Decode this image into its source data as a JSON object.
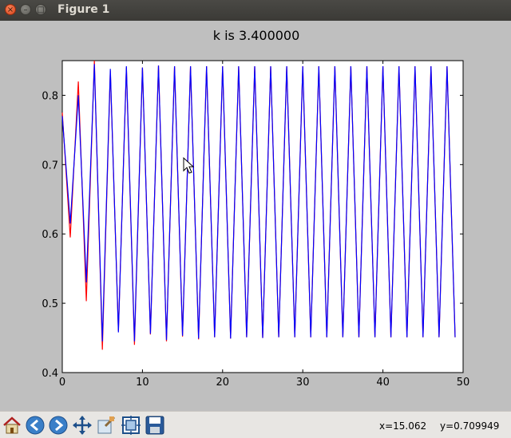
{
  "window": {
    "title": "Figure 1",
    "close_glyph": "×",
    "min_glyph": "–",
    "max_glyph": "□"
  },
  "toolbar": {
    "tools": [
      "home-icon",
      "back-icon",
      "forward-icon",
      "pan-icon",
      "zoom-icon",
      "subplots-icon",
      "save-icon"
    ],
    "x_readout": "x=15.062",
    "y_readout": "y=0.709949"
  },
  "chart_data": {
    "type": "line",
    "title": "k is 3.400000",
    "xlabel": "",
    "ylabel": "",
    "xlim": [
      0,
      50
    ],
    "ylim": [
      0.4,
      0.85
    ],
    "xticks": [
      0,
      10,
      20,
      30,
      40,
      50
    ],
    "yticks": [
      0.4,
      0.5,
      0.6,
      0.7,
      0.8
    ],
    "xtick_labels": [
      "0",
      "10",
      "20",
      "30",
      "40",
      "50"
    ],
    "ytick_labels": [
      "0.4",
      "0.5",
      "0.6",
      "0.7",
      "0.8"
    ],
    "grid": false,
    "legend": "none",
    "series": [
      {
        "color": "#ff0000",
        "x": [
          0,
          1,
          2,
          3,
          4,
          5,
          6,
          7,
          8,
          9,
          10,
          11,
          12,
          13,
          14,
          15,
          16,
          17,
          18,
          19,
          20,
          21,
          22,
          23,
          24,
          25,
          26,
          27,
          28,
          29,
          30,
          31,
          32,
          33,
          34,
          35,
          36,
          37,
          38,
          39,
          40,
          41,
          42,
          43,
          44,
          45,
          46,
          47,
          48,
          49
        ],
        "y": [
          0.775,
          0.595,
          0.82,
          0.503,
          0.85,
          0.433,
          0.835,
          0.46,
          0.84,
          0.44,
          0.84,
          0.455,
          0.843,
          0.445,
          0.842,
          0.452,
          0.842,
          0.448,
          0.842,
          0.451,
          0.842,
          0.449,
          0.842,
          0.451,
          0.842,
          0.45,
          0.842,
          0.451,
          0.842,
          0.451,
          0.842,
          0.451,
          0.842,
          0.451,
          0.842,
          0.451,
          0.842,
          0.451,
          0.842,
          0.451,
          0.842,
          0.451,
          0.842,
          0.451,
          0.842,
          0.451,
          0.842,
          0.451,
          0.842,
          0.451
        ]
      },
      {
        "color": "#0000ff",
        "x": [
          0,
          1,
          2,
          3,
          4,
          5,
          6,
          7,
          8,
          9,
          10,
          11,
          12,
          13,
          14,
          15,
          16,
          17,
          18,
          19,
          20,
          21,
          22,
          23,
          24,
          25,
          26,
          27,
          28,
          29,
          30,
          31,
          32,
          33,
          34,
          35,
          36,
          37,
          38,
          39,
          40,
          41,
          42,
          43,
          44,
          45,
          46,
          47,
          48,
          49
        ],
        "y": [
          0.77,
          0.615,
          0.8,
          0.53,
          0.845,
          0.445,
          0.838,
          0.458,
          0.842,
          0.445,
          0.84,
          0.456,
          0.843,
          0.447,
          0.842,
          0.453,
          0.842,
          0.449,
          0.842,
          0.451,
          0.842,
          0.449,
          0.842,
          0.451,
          0.842,
          0.45,
          0.842,
          0.451,
          0.842,
          0.451,
          0.842,
          0.451,
          0.842,
          0.451,
          0.842,
          0.451,
          0.842,
          0.451,
          0.842,
          0.451,
          0.842,
          0.451,
          0.842,
          0.451,
          0.842,
          0.451,
          0.842,
          0.451,
          0.842,
          0.451
        ]
      }
    ]
  }
}
